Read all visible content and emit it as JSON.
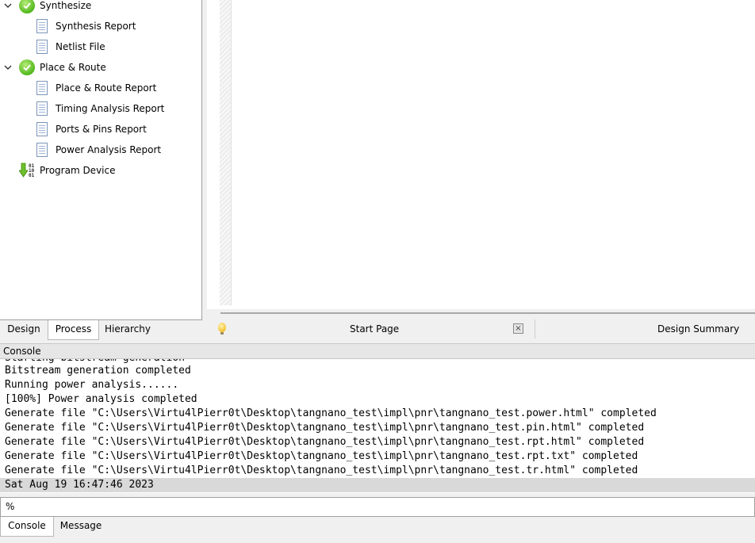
{
  "process_tree": [
    {
      "label": "Synthesize",
      "kind": "step",
      "expanded": true,
      "status": "ok"
    },
    {
      "label": "Synthesis Report",
      "kind": "report"
    },
    {
      "label": "Netlist File",
      "kind": "report"
    },
    {
      "label": "Place & Route",
      "kind": "step",
      "expanded": true,
      "status": "ok"
    },
    {
      "label": "Place & Route Report",
      "kind": "report"
    },
    {
      "label": "Timing Analysis Report",
      "kind": "report"
    },
    {
      "label": "Ports & Pins Report",
      "kind": "report"
    },
    {
      "label": "Power Analysis Report",
      "kind": "report"
    },
    {
      "label": "Program Device",
      "kind": "program"
    }
  ],
  "left_tabs": [
    "Design",
    "Process",
    "Hierarchy"
  ],
  "left_tab_active": "Process",
  "doc_tabs": {
    "start_page": "Start Page",
    "design_summary": "Design Summary",
    "close_glyph": "×"
  },
  "console": {
    "title": "Console",
    "lines": [
      "Bitstream generation completed",
      "Running power analysis......",
      "[100%] Power analysis completed",
      "Generate file \"C:\\Users\\Virtu4lPierr0t\\Desktop\\tangnano_test\\impl\\pnr\\tangnano_test.power.html\" completed",
      "Generate file \"C:\\Users\\Virtu4lPierr0t\\Desktop\\tangnano_test\\impl\\pnr\\tangnano_test.pin.html\" completed",
      "Generate file \"C:\\Users\\Virtu4lPierr0t\\Desktop\\tangnano_test\\impl\\pnr\\tangnano_test.rpt.html\" completed",
      "Generate file \"C:\\Users\\Virtu4lPierr0t\\Desktop\\tangnano_test\\impl\\pnr\\tangnano_test.rpt.txt\" completed",
      "Generate file \"C:\\Users\\Virtu4lPierr0t\\Desktop\\tangnano_test\\impl\\pnr\\tangnano_test.tr.html\" completed"
    ],
    "timestamp": "Sat Aug 19 16:47:46 2023",
    "prompt": "%",
    "input_value": ""
  },
  "bottom_tabs": [
    "Console",
    "Message"
  ],
  "bottom_tab_active": "Console"
}
